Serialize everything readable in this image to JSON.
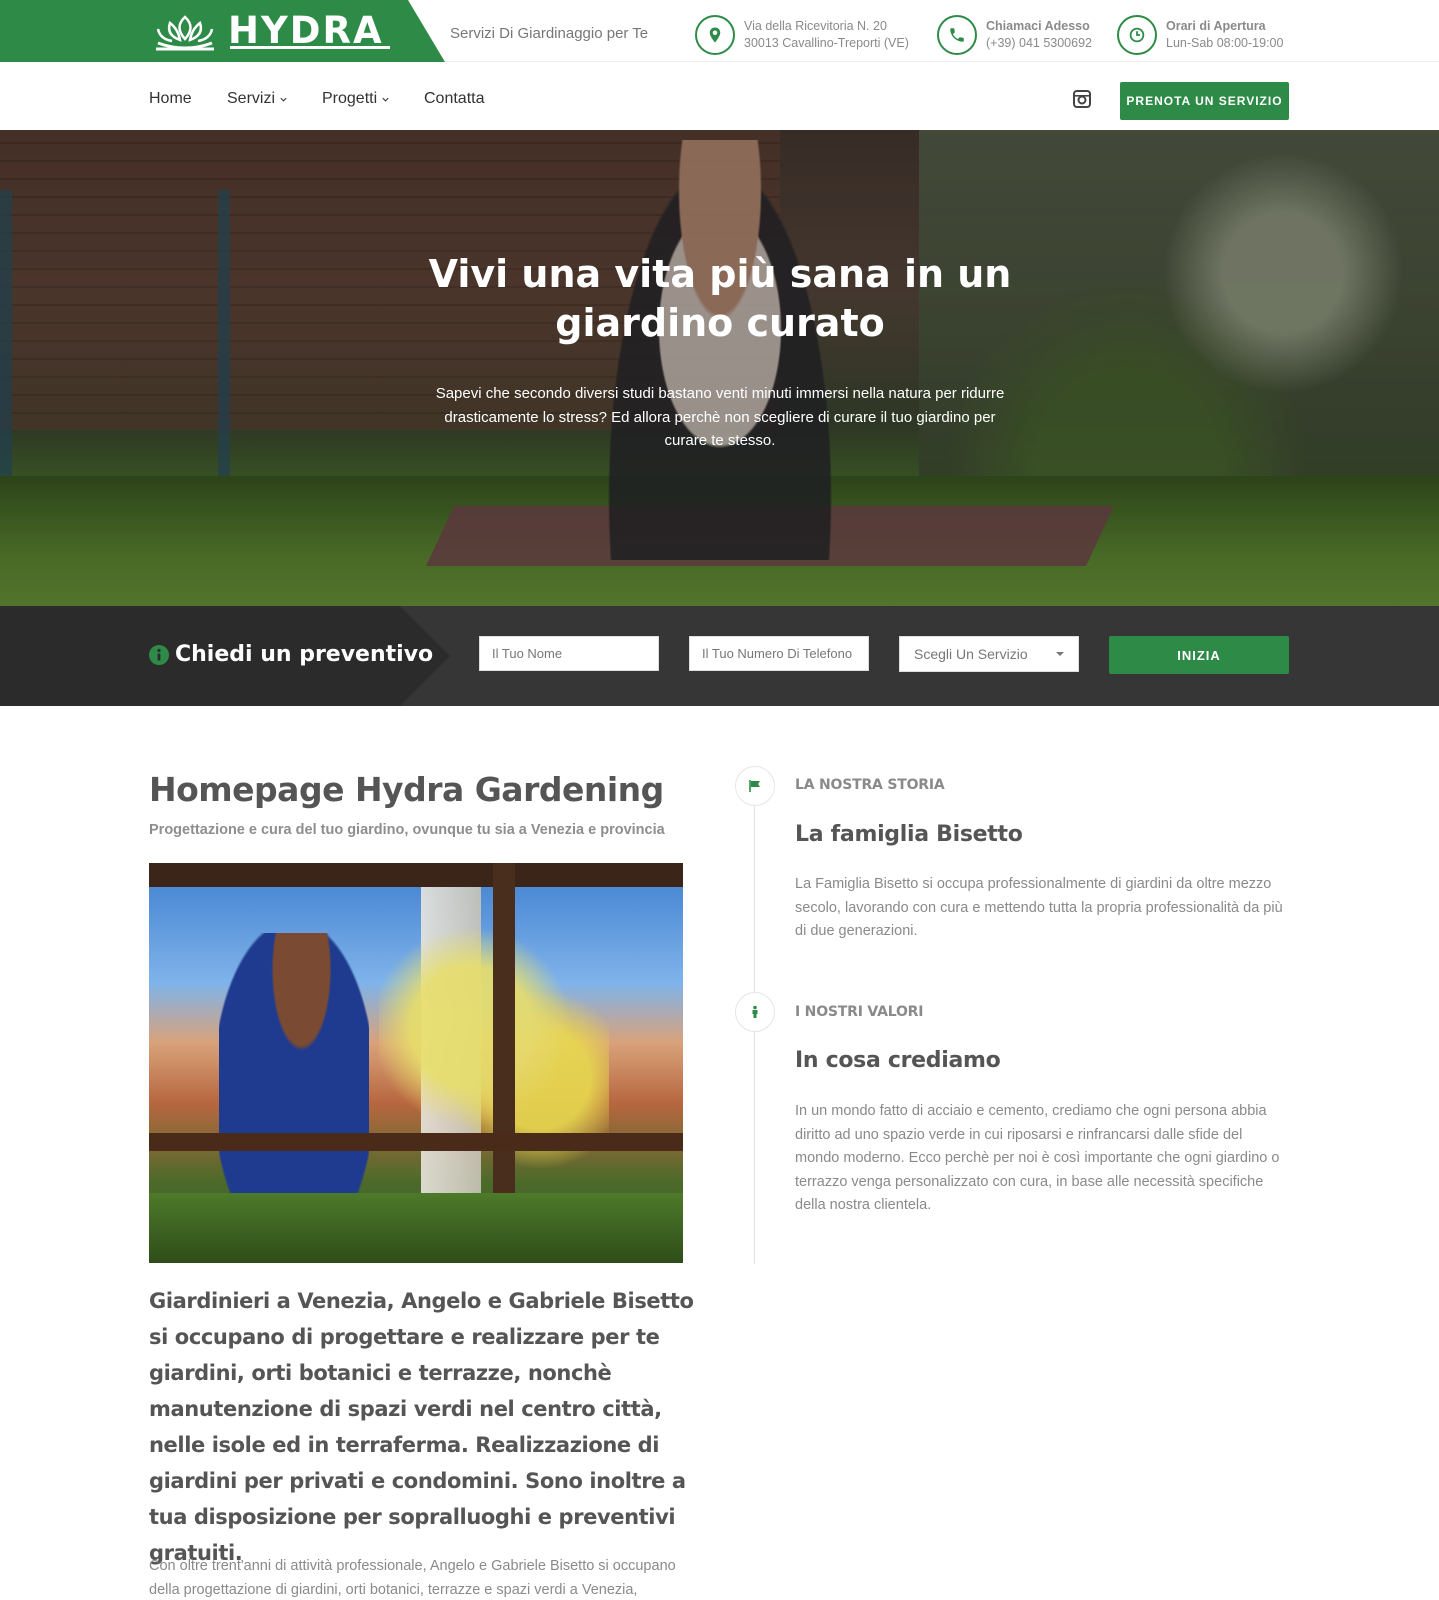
{
  "brand": {
    "logo_text": "HYDRA",
    "tagline": "Servizi Di Giardinaggio per Te",
    "accent_color": "#2e8b47"
  },
  "header_info": [
    {
      "icon": "map-pin-icon",
      "line1": "Via della Ricevitoria N. 20",
      "line2": "30013 Cavallino-Treporti (VE)"
    },
    {
      "icon": "phone-icon",
      "line1": "Chiamaci Adesso",
      "line2": "(+39) 041 5300692"
    },
    {
      "icon": "clock-icon",
      "line1": "Orari di Apertura",
      "line2": "Lun-Sab 08:00-19:00"
    }
  ],
  "nav": {
    "items": [
      {
        "label": "Home"
      },
      {
        "label": "Servizi"
      },
      {
        "label": "Progetti"
      },
      {
        "label": "Contatta"
      }
    ],
    "cta": "PRENOTA UN SERVIZIO"
  },
  "hero": {
    "title": "Vivi una vita più sana in un giardino curato",
    "subtitle": "Sapevi che secondo diversi studi bastano venti minuti immersi nella natura per ridurre drasticamente lo stress? Ed allora perchè non scegliere di curare il tuo giardino per curare te stesso."
  },
  "quote": {
    "title": "Chiedi un preventivo",
    "name_placeholder": "Il Tuo Nome",
    "phone_placeholder": "Il Tuo Numero Di Telefono",
    "service_selected": "Scegli Un Servizio",
    "submit": "INIZIA"
  },
  "main": {
    "title": "Homepage Hydra Gardening",
    "subtitle": "Progettazione e cura del tuo giardino, ovunque tu sia a Venezia e provincia",
    "lead": "Giardinieri a Venezia, Angelo e Gabriele Bisetto si occupano di progettare e realizzare per te giardini, orti botanici e terrazze, nonchè manutenzione di spazi verdi nel centro città, nelle isole ed in terraferma. Realizzazione di giardini per privati e condomini. Sono inoltre a tua disposizione per sopralluoghi e preventivi gratuiti.",
    "body": "Con oltre trent'anni di attività professionale, Angelo e Gabriele Bisetto si occupano della progettazione di giardini, orti botanici, terrazze e spazi verdi a Venezia,"
  },
  "timeline": [
    {
      "icon": "flag-icon",
      "kicker": "LA NOSTRA STORIA",
      "heading": "La famiglia Bisetto",
      "text": "La Famiglia Bisetto si occupa professionalmente di giardini da oltre mezzo secolo, lavorando con cura e mettendo tutta la propria professionalità da più di due generazioni."
    },
    {
      "icon": "person-icon",
      "kicker": "I NOSTRI VALORI",
      "heading": "In cosa crediamo",
      "text": "In un mondo fatto di acciaio e cemento, crediamo che ogni persona abbia diritto ad uno spazio verde in cui riposarsi e rinfrancarsi dalle sfide del mondo moderno. Ecco perchè per noi è così importante che ogni giardino o terrazzo venga personalizzato con cura, in base alle necessità specifiche della nostra clientela."
    }
  ]
}
